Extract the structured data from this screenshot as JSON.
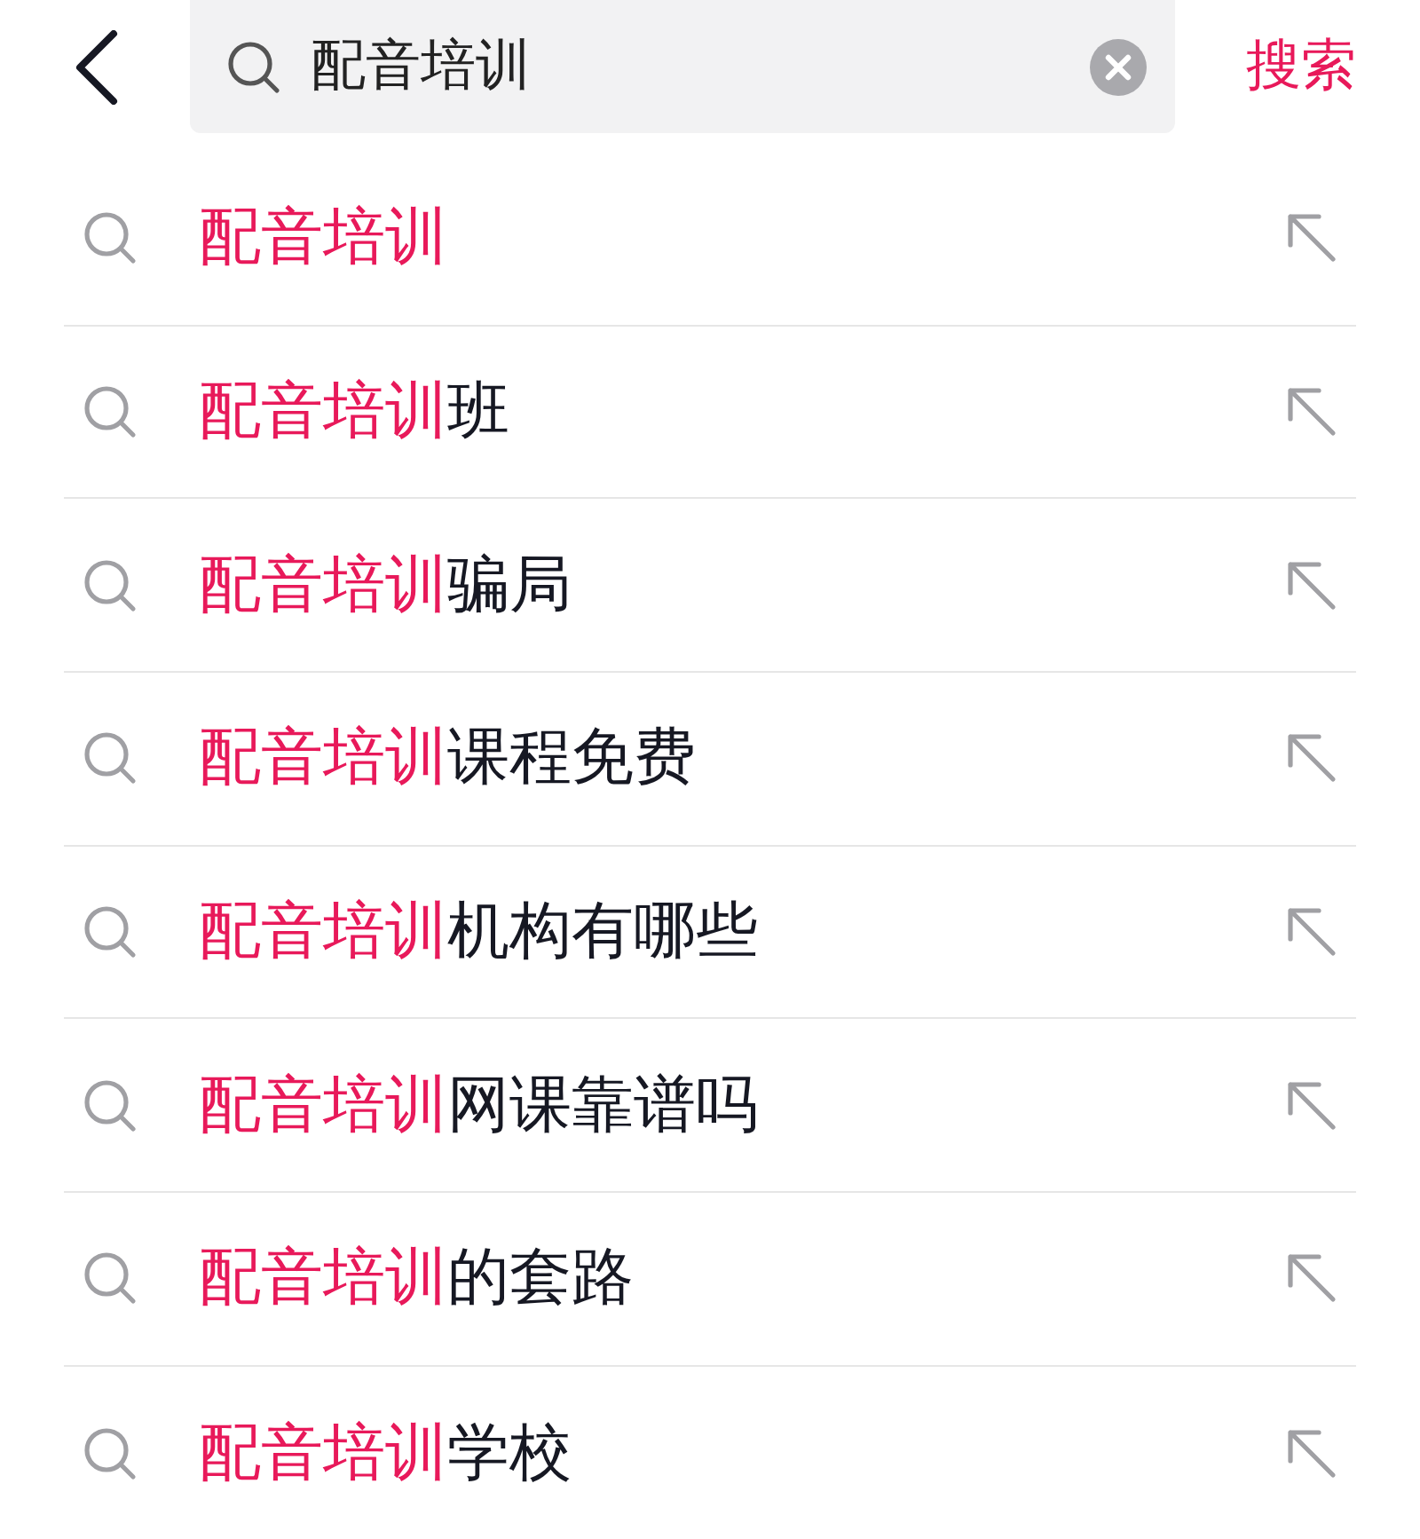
{
  "search_bar": {
    "query": "配音培训",
    "action": "搜索"
  },
  "suggestions": [
    {
      "highlight": "配音培训"
    },
    {
      "highlight": "配音培训",
      "rest": "班"
    },
    {
      "highlight": "配音培训",
      "rest": "骗局"
    },
    {
      "highlight": "配音培训",
      "rest": "课程免费"
    },
    {
      "highlight": "配音培训",
      "rest": "机构有哪些"
    },
    {
      "highlight": "配音培训",
      "rest": "网课靠谱吗"
    },
    {
      "highlight": "配音培训",
      "rest": "的套路"
    },
    {
      "highlight": "配音培训",
      "rest": "学校"
    }
  ]
}
